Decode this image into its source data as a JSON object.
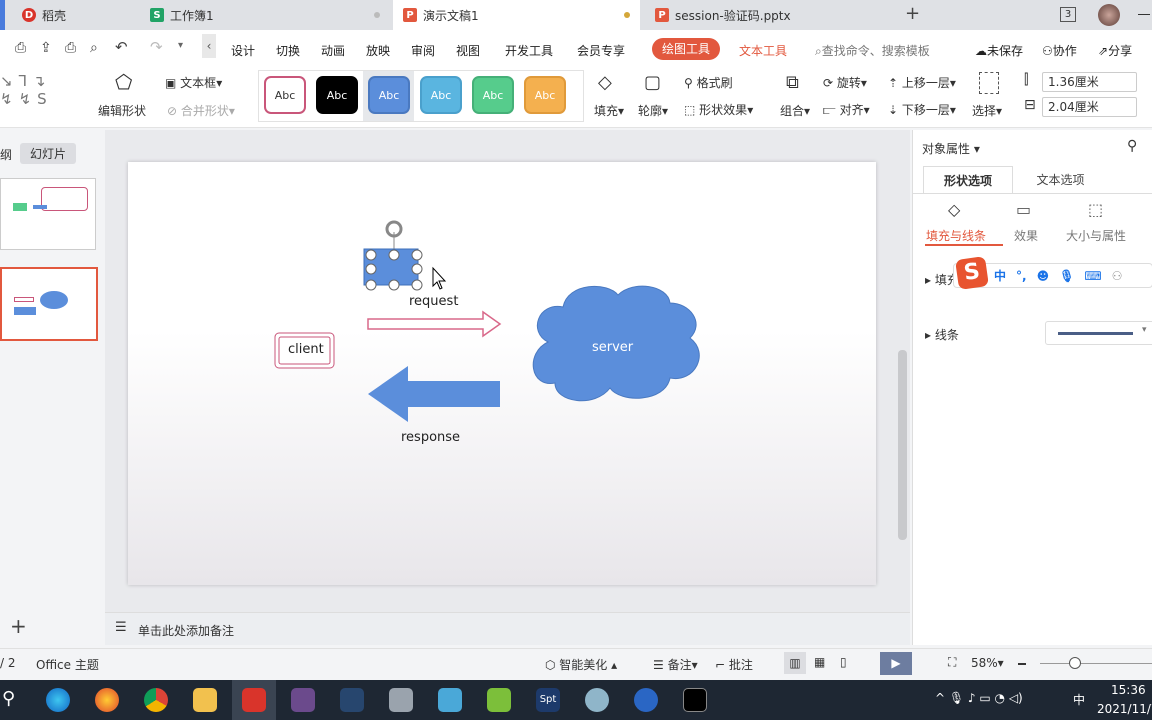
{
  "tabs": [
    {
      "label": "稻壳",
      "color": "#d9342b",
      "icon": "D"
    },
    {
      "label": "工作簿1",
      "color": "#21a366",
      "icon": "S"
    },
    {
      "label": "演示文稿1",
      "color": "#e2583e",
      "icon": "P",
      "active": true
    },
    {
      "label": "session-验证码.pptx",
      "color": "#e2583e",
      "icon": "P"
    }
  ],
  "tabbar": {
    "new_tab": "+",
    "window_count": "3"
  },
  "menu": [
    "设计",
    "切换",
    "动画",
    "放映",
    "审阅",
    "视图",
    "开发工具",
    "会员专享"
  ],
  "context_tabs": {
    "draw": "绘图工具",
    "text": "文本工具"
  },
  "search": "查找命令、搜索模板",
  "quick_right": {
    "unsaved": "未保存",
    "collab": "协作",
    "share": "分享"
  },
  "ribbon": {
    "edit_shape": "编辑形状",
    "textbox": "文本框",
    "merge_shape": "合并形状",
    "fill": "填充",
    "outline": "轮廓",
    "format_painter": "格式刷",
    "shape_effect": "形状效果",
    "group": "组合",
    "rotate": "旋转",
    "align": "对齐",
    "bring_forward": "上移一层",
    "send_backward": "下移一层",
    "select": "选择",
    "height": "1.36厘米",
    "width": "2.04厘米"
  },
  "styles": [
    {
      "label": "Abc",
      "bg": "#ffffff",
      "fg": "#333",
      "border": "#c9567a"
    },
    {
      "label": "Abc",
      "bg": "#000000",
      "fg": "#fff",
      "border": "#000"
    },
    {
      "label": "Abc",
      "bg": "#5b8edb",
      "fg": "#fff",
      "border": "#4a79c0"
    },
    {
      "label": "Abc",
      "bg": "#5ab5e0",
      "fg": "#fff",
      "border": "#4aa0cc"
    },
    {
      "label": "Abc",
      "bg": "#56cc8c",
      "fg": "#fff",
      "border": "#45b078"
    },
    {
      "label": "Abc",
      "bg": "#f4b04f",
      "fg": "#fff",
      "border": "#e09a3a"
    }
  ],
  "left_panel": {
    "outline_tab": "纲",
    "slides_tab": "幻灯片",
    "add": "+"
  },
  "slide": {
    "request": "request",
    "response": "response",
    "client": "client",
    "server": "server"
  },
  "notes": "单击此处添加备注",
  "right_panel": {
    "title": "对象属性",
    "tab_shape": "形状选项",
    "tab_text": "文本选项",
    "sub_fill": "填充与线条",
    "sub_effect": "效果",
    "sub_size": "大小与属性",
    "fill": "填充",
    "line": "线条"
  },
  "ime": {
    "lang": "中",
    "punct": "°,"
  },
  "status": {
    "page": "/ 2",
    "theme": "Office 主题",
    "beautify": "智能美化",
    "notes": "备注",
    "comment": "批注",
    "zoom": "58%"
  },
  "taskbar": {
    "time": "15:36",
    "date": "2021/11/7",
    "lang": "中"
  },
  "accent": "#e2583e"
}
